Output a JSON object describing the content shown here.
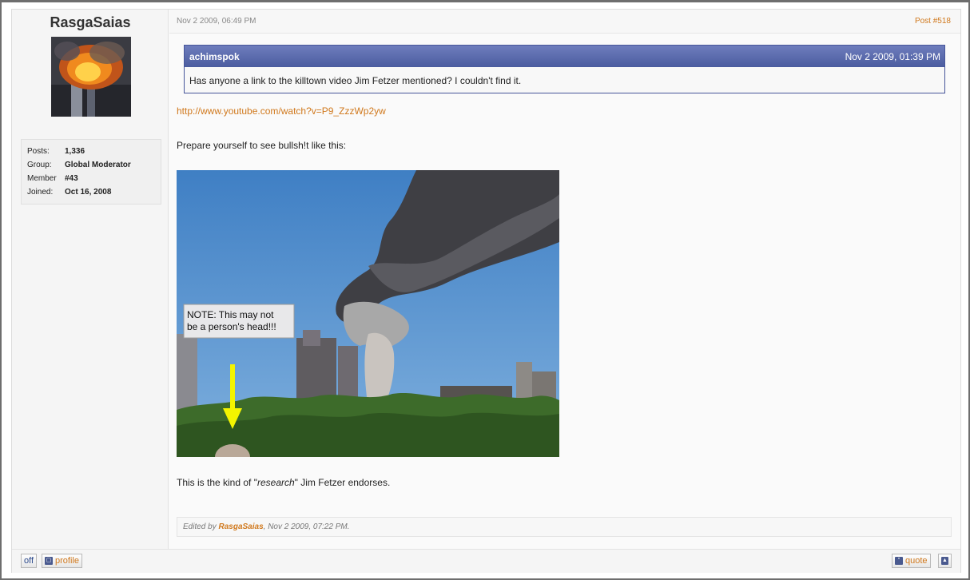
{
  "author": {
    "name": "RasgaSaias",
    "stats": [
      {
        "label": "Posts:",
        "value": "1,336"
      },
      {
        "label": "Group:",
        "value": "Global Moderator"
      },
      {
        "label": "Member",
        "value": "#43"
      },
      {
        "label": "Joined:",
        "value": "Oct 16, 2008"
      }
    ]
  },
  "post": {
    "date": "Nov 2 2009, 06:49 PM",
    "number": "Post #518",
    "quote": {
      "author": "achimspok",
      "date": "Nov 2 2009, 01:39 PM",
      "text": "Has anyone a link to the killtown video Jim Fetzer mentioned? I couldn't find it."
    },
    "link": "http://www.youtube.com/watch?v=P9_ZzzWp2yw",
    "para1": "Prepare yourself to see bullsh!t like this:",
    "image_note_line1": "NOTE:  This may not",
    "image_note_line2": "be a person's head!!!",
    "para2_before": "This is the kind of \"",
    "para2_italic": "research",
    "para2_after": "\" Jim Fetzer endorses.",
    "edited": {
      "prefix": "Edited by ",
      "by": "RasgaSaias",
      "suffix": ", Nov 2 2009, 07:22 PM."
    }
  },
  "footer": {
    "off_label": "off",
    "profile_label": "profile",
    "quote_label": "quote"
  },
  "colors": {
    "accent": "#d0781c",
    "quote_header": "#5a69ab"
  }
}
